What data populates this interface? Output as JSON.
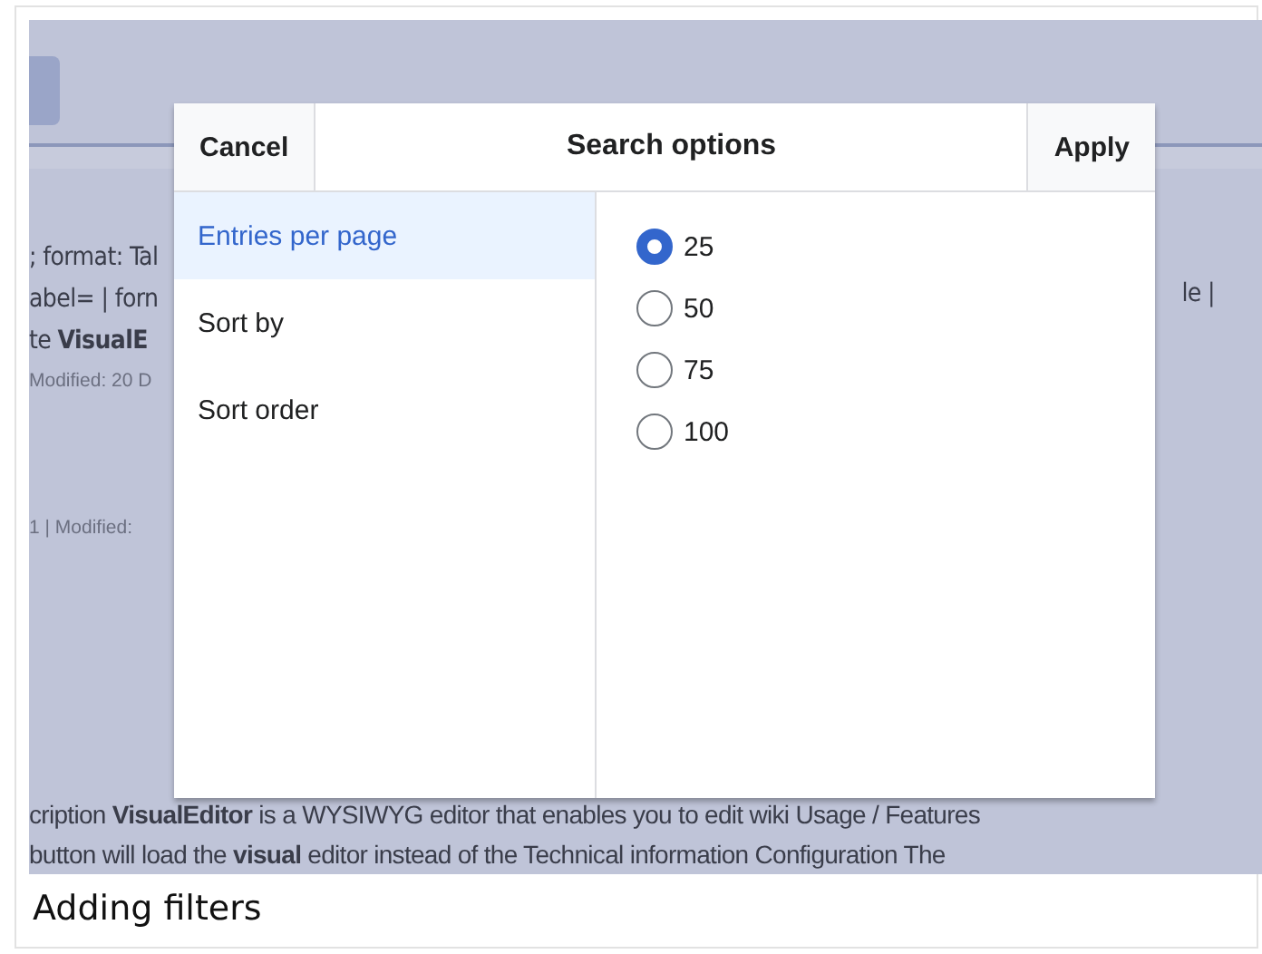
{
  "background": {
    "left_fragments": [
      "; format: Tal",
      "abel= | forn",
      "te **VisualE**",
      "Modified: 20 D"
    ],
    "right_fragment": "le |",
    "meta_fragment": "1 | Modified:",
    "lines": [
      "cription **VisualEditor** is a WYSIWYG editor that enables you to edit wiki Usage / Features",
      "button will load the **visual** editor instead of the Technical information Configuration The"
    ]
  },
  "dialog": {
    "cancel": "Cancel",
    "title": "Search options",
    "apply": "Apply",
    "menu": [
      {
        "label": "Entries per page",
        "selected": true
      },
      {
        "label": "Sort by",
        "selected": false
      },
      {
        "label": "Sort order",
        "selected": false
      }
    ],
    "options": [
      {
        "label": "25",
        "selected": true
      },
      {
        "label": "50",
        "selected": false
      },
      {
        "label": "75",
        "selected": false
      },
      {
        "label": "100",
        "selected": false
      }
    ]
  },
  "caption": "Adding filters"
}
